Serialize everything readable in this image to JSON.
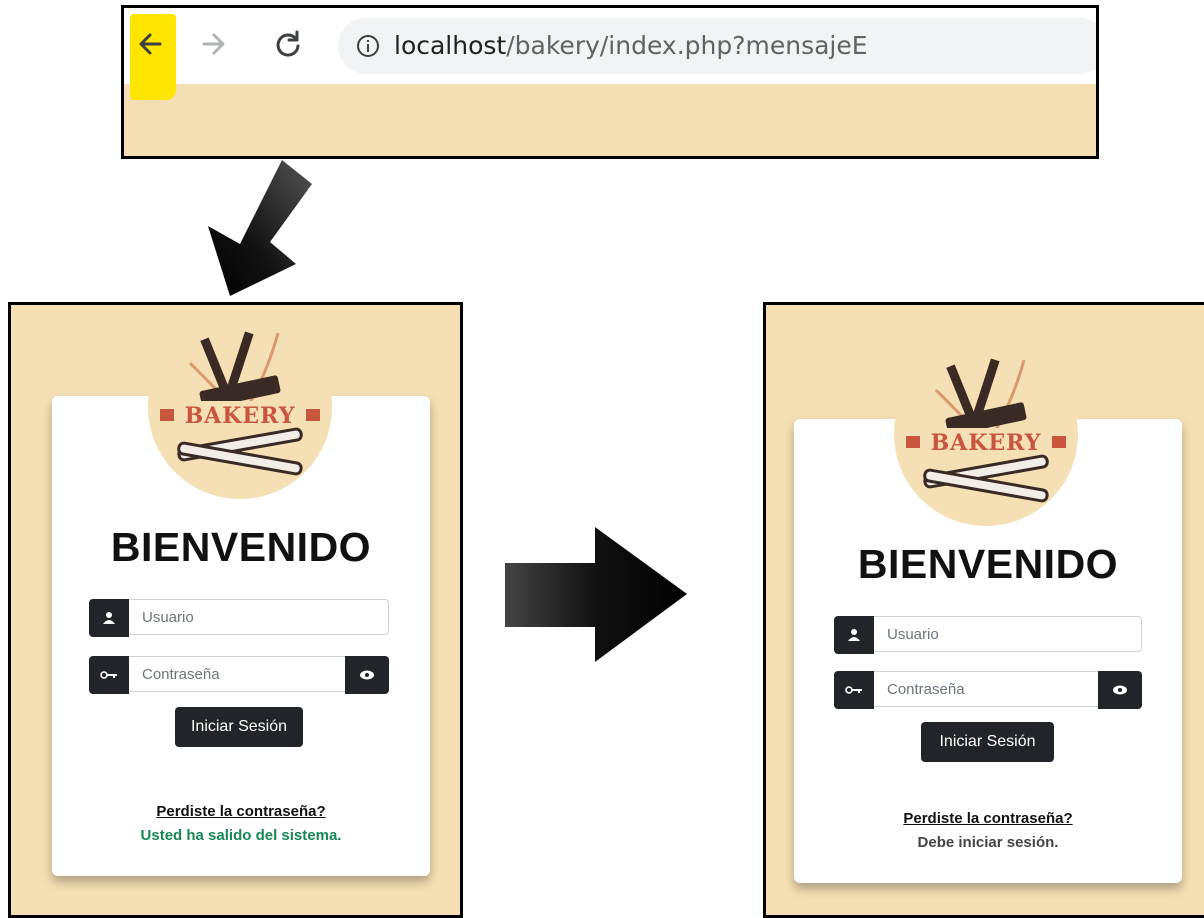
{
  "browser": {
    "url_host": "localhost",
    "url_path": "/bakery/index.php?mensajeE",
    "icons": [
      "back-arrow-icon",
      "forward-arrow-icon",
      "reload-icon",
      "info-icon"
    ],
    "highlight_color": "#ffe600",
    "page_bg": "#f5dfb4"
  },
  "panels": {
    "left": {
      "logo_text": "BAKERY",
      "title": "BIENVENIDO",
      "username_placeholder": "Usuario",
      "password_placeholder": "Contraseña",
      "login_label": "Iniciar Sesión",
      "forgot_label": "Perdiste la contraseña?",
      "message": "Usted ha salido del sistema.",
      "message_color": "#198754"
    },
    "right": {
      "logo_text": "BAKERY",
      "title": "BIENVENIDO",
      "username_placeholder": "Usuario",
      "password_placeholder": "Contraseña",
      "login_label": "Iniciar Sesión",
      "forgot_label": "Perdiste la contraseña?",
      "message": "Debe iniciar sesión.",
      "message_color": "#444444"
    }
  },
  "colors": {
    "background": "#f5dfb4",
    "dark": "#212529",
    "logo_accent": "#c8553d"
  }
}
